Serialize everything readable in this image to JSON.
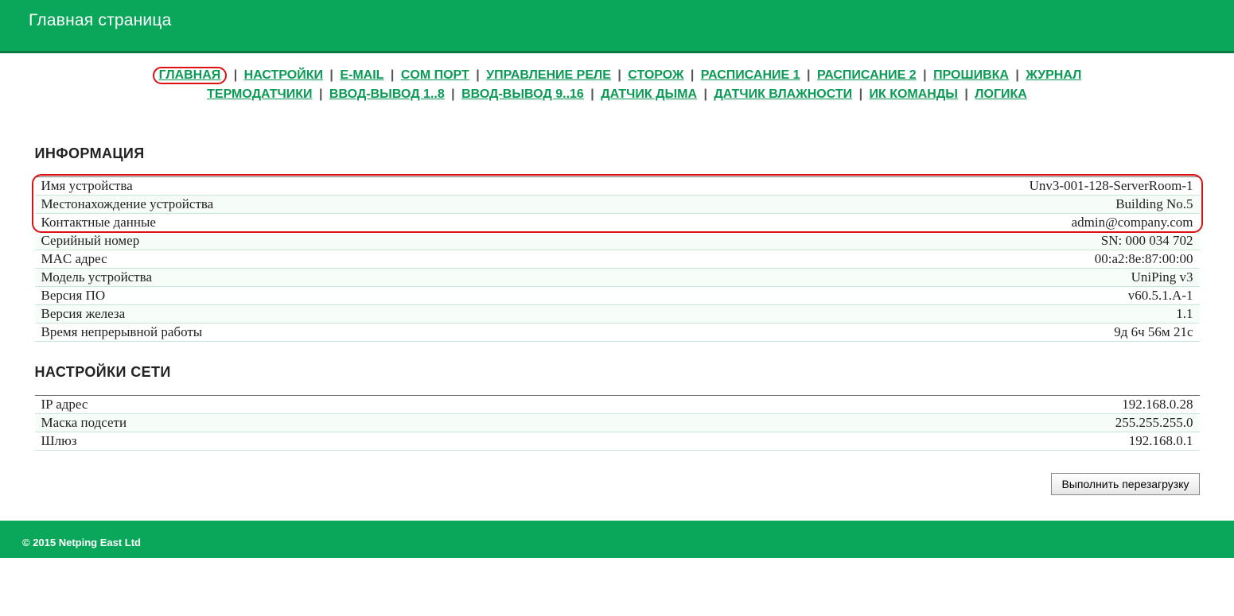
{
  "header": {
    "title": "Главная страница"
  },
  "nav": {
    "row1": [
      {
        "label": "ГЛАВНАЯ",
        "active": true
      },
      {
        "label": "НАСТРОЙКИ",
        "active": false
      },
      {
        "label": "E-MAIL",
        "active": false
      },
      {
        "label": "COM ПОРТ",
        "active": false
      },
      {
        "label": "УПРАВЛЕНИЕ РЕЛЕ",
        "active": false
      },
      {
        "label": "СТОРОЖ",
        "active": false
      },
      {
        "label": "РАСПИСАНИЕ 1",
        "active": false
      },
      {
        "label": "РАСПИСАНИЕ 2",
        "active": false
      },
      {
        "label": "ПРОШИВКА",
        "active": false
      },
      {
        "label": "ЖУРНАЛ",
        "active": false
      }
    ],
    "row2": [
      {
        "label": "ТЕРМОДАТЧИКИ",
        "active": false
      },
      {
        "label": "ВВОД-ВЫВОД 1..8",
        "active": false
      },
      {
        "label": "ВВОД-ВЫВОД 9..16",
        "active": false
      },
      {
        "label": "ДАТЧИК ДЫМА",
        "active": false
      },
      {
        "label": "ДАТЧИК ВЛАЖНОСТИ",
        "active": false
      },
      {
        "label": "ИК КОМАНДЫ",
        "active": false
      },
      {
        "label": "ЛОГИКА",
        "active": false
      }
    ]
  },
  "sections": {
    "info_title": "ИНФОРМАЦИЯ",
    "network_title": "НАСТРОЙКИ СЕТИ"
  },
  "info": [
    {
      "label": "Имя устройства",
      "value": "Unv3-001-128-ServerRoom-1",
      "hl": true
    },
    {
      "label": "Местонахождение устройства",
      "value": "Building No.5",
      "hl": true
    },
    {
      "label": "Контактные данные",
      "value": "admin@company.com",
      "hl": true
    },
    {
      "label": "Серийный номер",
      "value": "SN: 000 034 702",
      "hl": false
    },
    {
      "label": "MAC адрес",
      "value": "00:a2:8e:87:00:00",
      "hl": false
    },
    {
      "label": "Модель устройства",
      "value": "UniPing v3",
      "hl": false
    },
    {
      "label": "Версия ПО",
      "value": "v60.5.1.A-1",
      "hl": false
    },
    {
      "label": "Версия железа",
      "value": "1.1",
      "hl": false
    },
    {
      "label": "Время непрерывной работы",
      "value": "9д 6ч 56м 21с",
      "hl": false
    }
  ],
  "network": [
    {
      "label": "IP адрес",
      "value": "192.168.0.28"
    },
    {
      "label": "Маска подсети",
      "value": "255.255.255.0"
    },
    {
      "label": "Шлюз",
      "value": "192.168.0.1"
    }
  ],
  "actions": {
    "reboot": "Выполнить перезагрузку"
  },
  "footer": {
    "copyright": "© 2015 Netping East Ltd"
  }
}
